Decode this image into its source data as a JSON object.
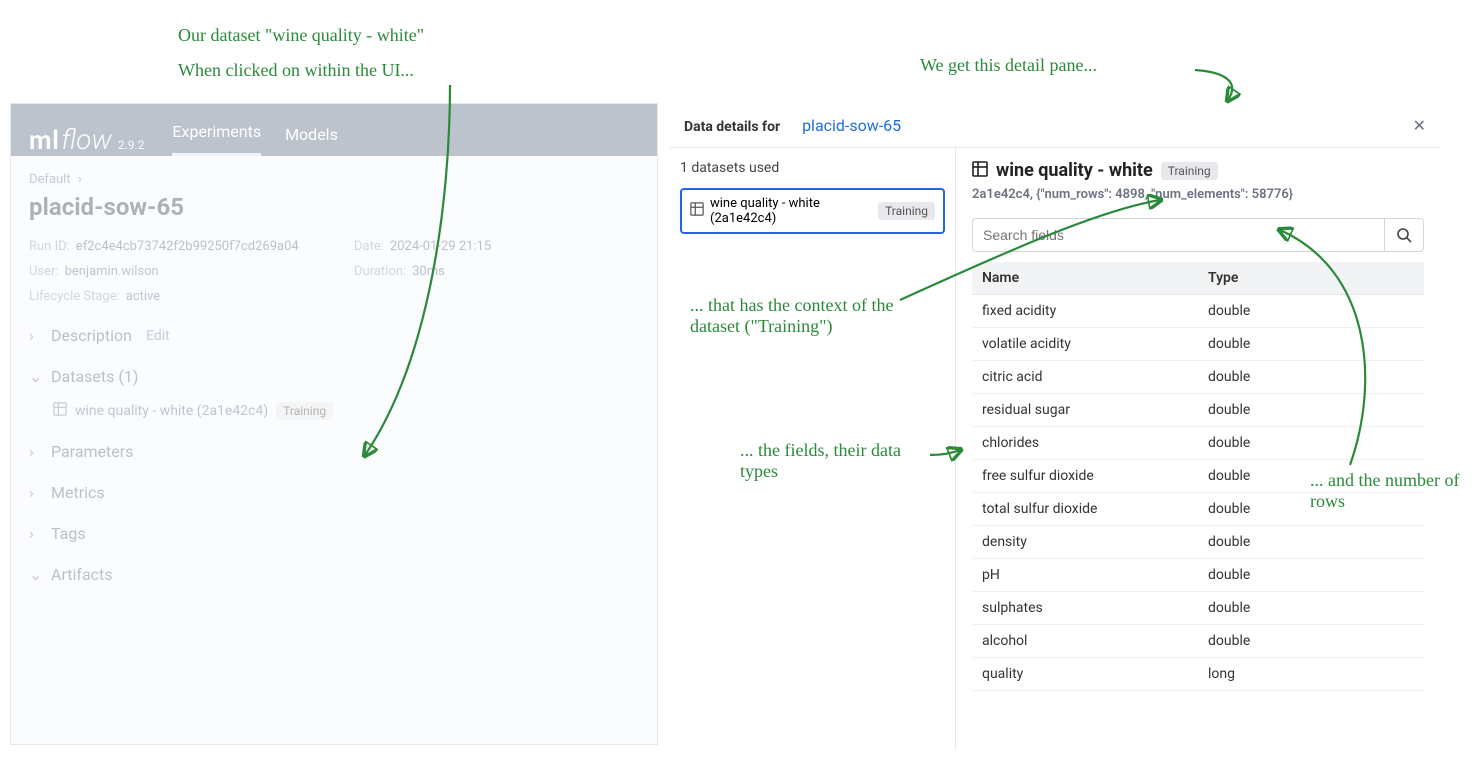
{
  "annotations": {
    "top_left_1": "Our dataset \"wine quality - white\"",
    "top_left_2": "When clicked on within the UI...",
    "top_right": "We get this detail pane...",
    "context": "... that has the context of the dataset (\"Training\")",
    "fields": "... the fields, their data types",
    "rows": "... and the number of rows"
  },
  "header": {
    "brand_ml": "ml",
    "brand_flow": "flow",
    "version": "2.9.2",
    "tab_experiments": "Experiments",
    "tab_models": "Models"
  },
  "run": {
    "breadcrumb_root": "Default",
    "name": "placid-sow-65",
    "run_id_label": "Run ID:",
    "run_id": "ef2c4e4cb73742f2b99250f7cd269a04",
    "user_label": "User:",
    "user": "benjamin.wilson",
    "lifecycle_label": "Lifecycle Stage:",
    "lifecycle": "active",
    "date_label": "Date:",
    "date": "2024-01-29 21:15",
    "duration_label": "Duration:",
    "duration": "30ms",
    "description_label": "Description",
    "description_edit": "Edit",
    "datasets_label": "Datasets (1)",
    "dataset_entry": "wine quality - white (2a1e42c4)",
    "dataset_tag": "Training",
    "parameters_label": "Parameters",
    "metrics_label": "Metrics",
    "tags_label": "Tags",
    "artifacts_label": "Artifacts"
  },
  "detail": {
    "header_label": "Data details for",
    "run_link": "placid-sow-65",
    "datasets_used": "1 datasets used",
    "selected_ds": "wine quality - white (2a1e42c4)",
    "selected_ds_tag": "Training",
    "ds_title": "wine quality - white",
    "ds_tag": "Training",
    "ds_meta": "2a1e42c4, {\"num_rows\": 4898, \"num_elements\": 58776}",
    "search_placeholder": "Search fields",
    "col_name": "Name",
    "col_type": "Type",
    "fields": [
      {
        "name": "fixed acidity",
        "type": "double"
      },
      {
        "name": "volatile acidity",
        "type": "double"
      },
      {
        "name": "citric acid",
        "type": "double"
      },
      {
        "name": "residual sugar",
        "type": "double"
      },
      {
        "name": "chlorides",
        "type": "double"
      },
      {
        "name": "free sulfur dioxide",
        "type": "double"
      },
      {
        "name": "total sulfur dioxide",
        "type": "double"
      },
      {
        "name": "density",
        "type": "double"
      },
      {
        "name": "pH",
        "type": "double"
      },
      {
        "name": "sulphates",
        "type": "double"
      },
      {
        "name": "alcohol",
        "type": "double"
      },
      {
        "name": "quality",
        "type": "long"
      }
    ]
  }
}
